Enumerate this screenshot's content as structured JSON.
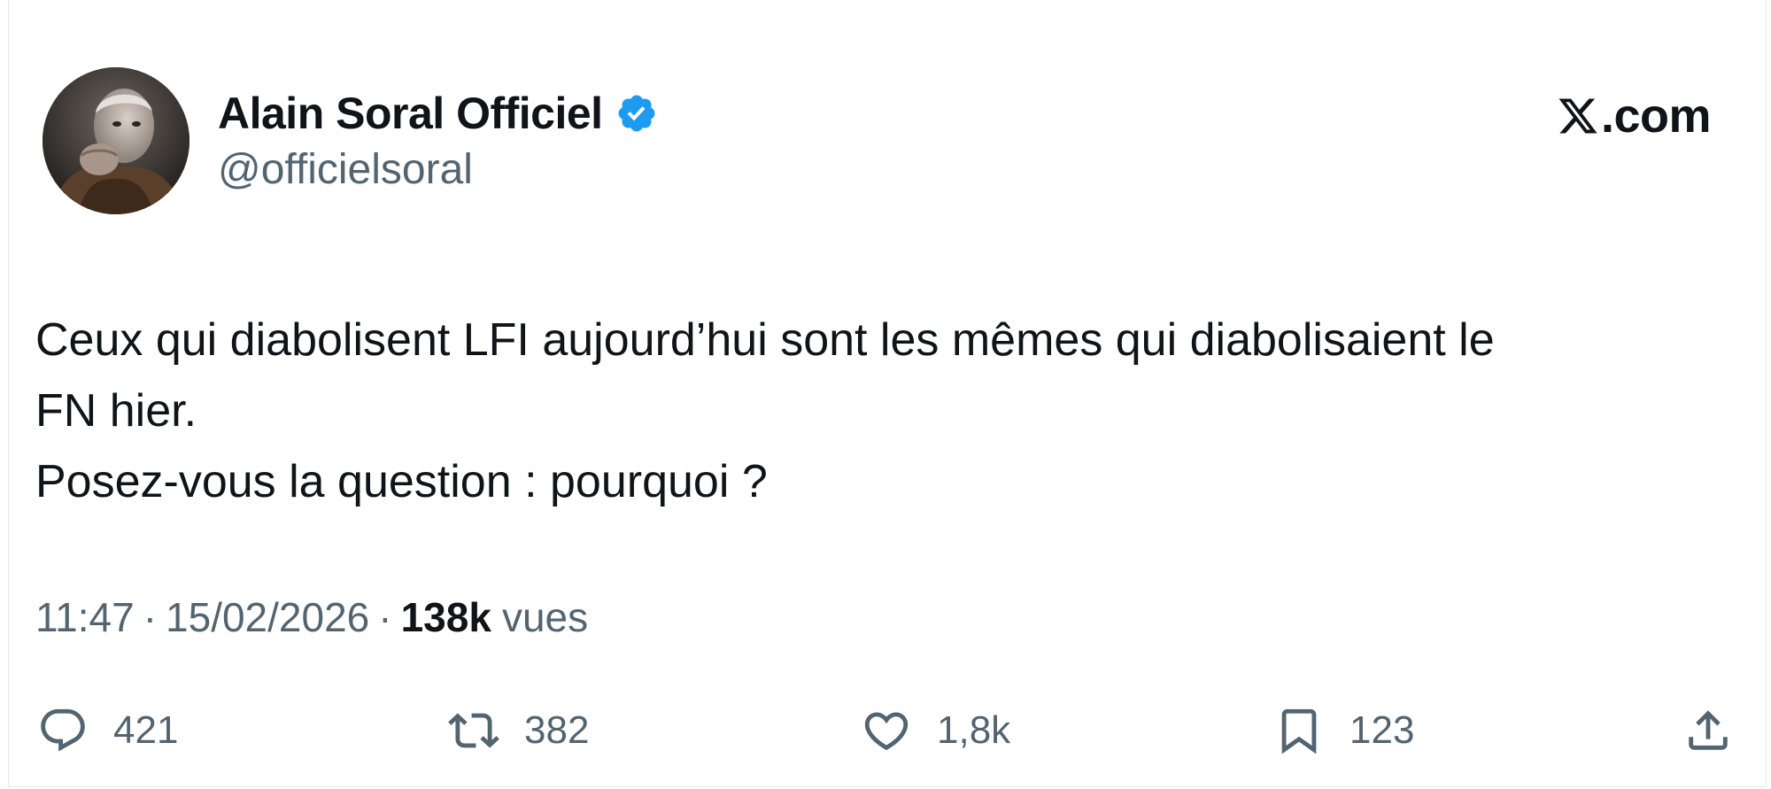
{
  "author": {
    "display_name": "Alain Soral Officiel",
    "handle": "@officielsoral",
    "verified": true,
    "verified_badge_color": "#1d9bf0",
    "avatar_icon": "user-avatar"
  },
  "brand": {
    "logo_icon": "x-logo-icon",
    "text": ".com"
  },
  "tweet": {
    "lines": [
      "Ceux qui diabolisent LFI aujourd’hui sont les mêmes qui diabolisaient le",
      "FN hier.",
      "Posez-vous la question : pourquoi ?"
    ]
  },
  "meta": {
    "time": "11:47",
    "separator": "·",
    "date": "15/02/2026",
    "views_count": "138k",
    "views_label": "vues"
  },
  "actions": {
    "reply": {
      "icon": "reply-icon",
      "count": "421"
    },
    "repost": {
      "icon": "repost-icon",
      "count": "382"
    },
    "like": {
      "icon": "heart-icon",
      "count": "1,8k"
    },
    "bookmark": {
      "icon": "bookmark-icon",
      "count": "123"
    },
    "share": {
      "icon": "share-icon"
    }
  },
  "colors": {
    "text_primary": "#0f1419",
    "text_secondary": "#536471",
    "accent": "#1d9bf0"
  }
}
